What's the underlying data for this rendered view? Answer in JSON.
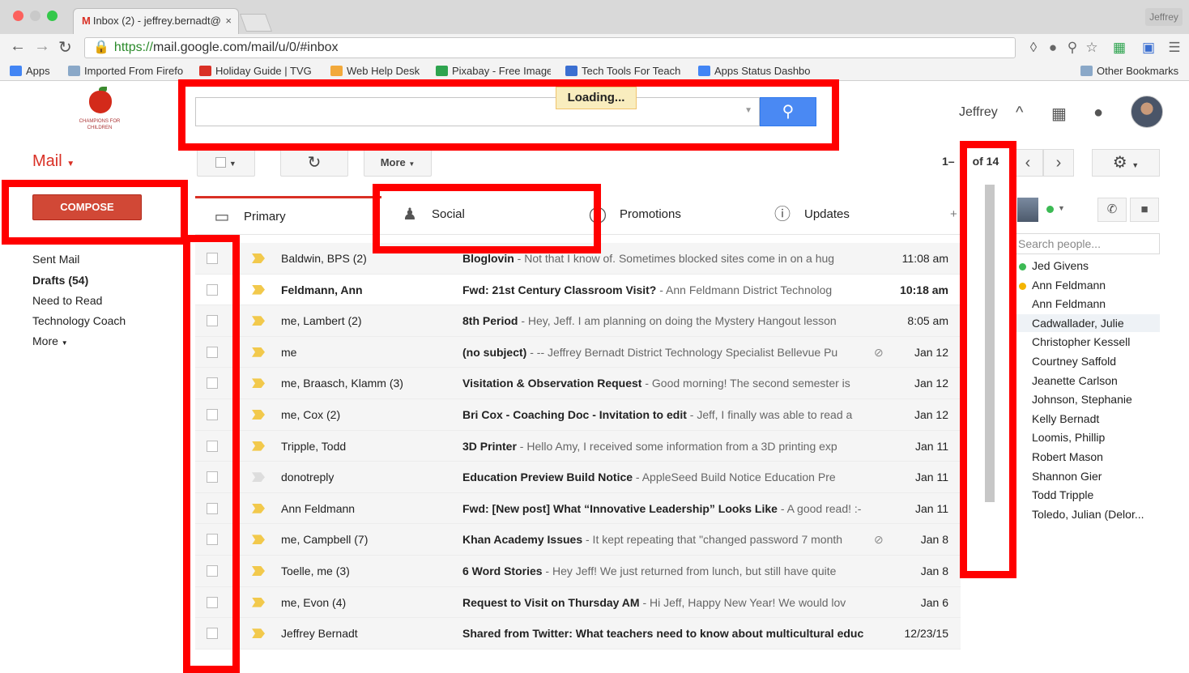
{
  "browser": {
    "tab_title": "Inbox (2) - jeffrey.bernadt@",
    "tab_close": "×",
    "profile_name": "Jeffrey",
    "url_scheme": "https://",
    "url_rest": "mail.google.com/mail/u/0/#inbox",
    "bookmarks": [
      {
        "label": "Apps",
        "icon": "apps-grid-icon",
        "color": "#4285f4"
      },
      {
        "label": "Imported From Firefo",
        "icon": "folder-icon",
        "color": "#8aa8c8"
      },
      {
        "label": "Holiday Guide | TVG",
        "icon": "tvg-icon",
        "color": "#d93025"
      },
      {
        "label": "Web Help Desk",
        "icon": "help-desk-icon",
        "color": "#f2a93b"
      },
      {
        "label": "Pixabay - Free Image",
        "icon": "pixabay-icon",
        "color": "#2ea44f"
      },
      {
        "label": "Tech Tools For Teach",
        "icon": "tech-tools-icon",
        "color": "#3b6fd1"
      },
      {
        "label": "Apps Status Dashbo",
        "icon": "google-g-icon",
        "color": "#4285f4"
      }
    ],
    "other_bookmarks": "Other Bookmarks"
  },
  "header": {
    "loading": "Loading...",
    "user_name": "Jeffrey",
    "logo_text": "CHAMPIONS FOR CHILDREN"
  },
  "toolbar": {
    "mail_label": "Mail",
    "more_label": "More",
    "pager_range": "1–",
    "pager_total": "of 14"
  },
  "sidebar": {
    "compose": "COMPOSE",
    "items": [
      "Sent Mail",
      "Drafts (54)",
      "Need to Read",
      "Technology Coach",
      "More"
    ]
  },
  "tabs": [
    "Primary",
    "Social",
    "Promotions",
    "Updates"
  ],
  "emails": [
    {
      "sender": "Baldwin, BPS (2)",
      "subject": "Bloglovin",
      "snippet": " - Not that I know of. Sometimes blocked sites come in on a hug",
      "date": "11:08 am",
      "unread": false,
      "important": true,
      "attachment": false
    },
    {
      "sender": "Feldmann, Ann",
      "subject": "Fwd: 21st Century Classroom Visit?",
      "snippet": " - Ann Feldmann District Technolog",
      "date": "10:18 am",
      "unread": true,
      "important": true,
      "attachment": false
    },
    {
      "sender": "me, Lambert (2)",
      "subject": "8th Period",
      "snippet": " - Hey, Jeff. I am planning on doing the Mystery Hangout lesson",
      "date": "8:05 am",
      "unread": false,
      "important": true,
      "attachment": false
    },
    {
      "sender": "me",
      "subject": "(no subject)",
      "snippet": " - -- Jeffrey Bernadt District Technology Specialist Bellevue Pu",
      "date": "Jan 12",
      "unread": false,
      "important": true,
      "attachment": true
    },
    {
      "sender": "me, Braasch, Klamm (3)",
      "subject": "Visitation & Observation Request",
      "snippet": " - Good morning! The second semester is",
      "date": "Jan 12",
      "unread": false,
      "important": true,
      "attachment": false
    },
    {
      "sender": "me, Cox (2)",
      "subject": "Bri Cox - Coaching Doc - Invitation to edit",
      "snippet": " - Jeff, I finally was able to read a",
      "date": "Jan 12",
      "unread": false,
      "important": true,
      "attachment": false
    },
    {
      "sender": "Tripple, Todd",
      "subject": "3D Printer",
      "snippet": " - Hello Amy, I received some information from a 3D printing exp",
      "date": "Jan 11",
      "unread": false,
      "important": true,
      "attachment": false
    },
    {
      "sender": "donotreply",
      "subject": "Education Preview Build Notice",
      "snippet": " - AppleSeed Build Notice Education Pre",
      "date": "Jan 11",
      "unread": false,
      "important": false,
      "attachment": false
    },
    {
      "sender": "Ann Feldmann",
      "subject": "Fwd: [New post] What “Innovative Leadership” Looks Like",
      "snippet": " - A good read! :-",
      "date": "Jan 11",
      "unread": false,
      "important": true,
      "attachment": false
    },
    {
      "sender": "me, Campbell (7)",
      "subject": "Khan Academy Issues",
      "snippet": " - It kept repeating that \"changed password 7 month",
      "date": "Jan 8",
      "unread": false,
      "important": true,
      "attachment": true
    },
    {
      "sender": "Toelle, me (3)",
      "subject": "6 Word Stories",
      "snippet": " - Hey Jeff! We just returned from lunch, but still have quite",
      "date": "Jan 8",
      "unread": false,
      "important": true,
      "attachment": false
    },
    {
      "sender": "me, Evon (4)",
      "subject": "Request to Visit on Thursday AM",
      "snippet": " - Hi Jeff, Happy New Year! We would lov",
      "date": "Jan 6",
      "unread": false,
      "important": true,
      "attachment": false
    },
    {
      "sender": "Jeffrey Bernadt",
      "subject": "Shared from Twitter: What teachers need to know about multicultural educ",
      "snippet": "",
      "date": "12/23/15",
      "unread": false,
      "important": true,
      "attachment": false
    }
  ],
  "chat": {
    "search_placeholder": "Search people...",
    "contacts": [
      {
        "name": "Jed Givens",
        "status": "#3cba54"
      },
      {
        "name": "Ann Feldmann",
        "status": "#f4b400"
      },
      {
        "name": "Ann Feldmann",
        "status": ""
      },
      {
        "name": "Cadwallader, Julie",
        "status": ""
      },
      {
        "name": "Christopher Kessell",
        "status": ""
      },
      {
        "name": "Courtney Saffold",
        "status": ""
      },
      {
        "name": "Jeanette Carlson",
        "status": ""
      },
      {
        "name": "Johnson, Stephanie",
        "status": ""
      },
      {
        "name": "Kelly Bernadt",
        "status": ""
      },
      {
        "name": "Loomis, Phillip",
        "status": ""
      },
      {
        "name": "Robert Mason",
        "status": ""
      },
      {
        "name": "Shannon Gier",
        "status": ""
      },
      {
        "name": "Todd Tripple",
        "status": ""
      },
      {
        "name": "Toledo, Julian (Delor...",
        "status": ""
      }
    ]
  },
  "colors": {
    "accent": "#d93025",
    "callout": "#ff0000",
    "search_button": "#4a89f3"
  }
}
